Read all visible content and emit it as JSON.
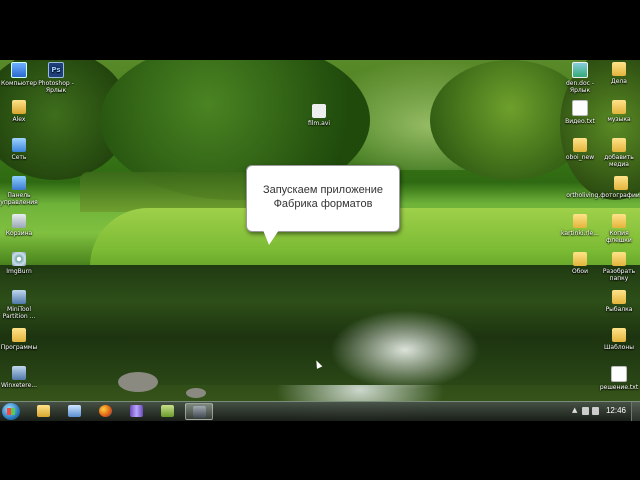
{
  "desktop_icons_left": [
    {
      "label": "Компьютер",
      "icon": "computer-icon"
    },
    {
      "label": "Photoshop - Ярлык",
      "icon": "photoshop-icon"
    },
    {
      "label": "Alex",
      "icon": "user-folder-icon"
    },
    {
      "label": "Сеть",
      "icon": "network-icon"
    },
    {
      "label": "Панель управления",
      "icon": "control-panel-icon"
    },
    {
      "label": "Корзина",
      "icon": "recycle-bin-icon"
    },
    {
      "label": "ImgBurn",
      "icon": "imgburn-icon"
    },
    {
      "label": "MiniTool Partition ...",
      "icon": "minitool-icon"
    },
    {
      "label": "Программы",
      "icon": "folder-icon"
    },
    {
      "label": "Winxetere...",
      "icon": "program-icon"
    }
  ],
  "center_icon": {
    "label": "film.avi",
    "icon": "video-file-icon"
  },
  "desktop_icons_right": [
    {
      "label": "den.doc - Ярлык",
      "icon": "shortcut-icon"
    },
    {
      "label": "Дела",
      "icon": "folder-icon"
    },
    {
      "label": "Видео.txt",
      "icon": "text-file-icon"
    },
    {
      "label": "музыка",
      "icon": "folder-icon"
    },
    {
      "label": "oboi_new",
      "icon": "folder-icon"
    },
    {
      "label": "добавить медиа",
      "icon": "folder-icon"
    },
    {
      "label": "ortholiving.фотографии",
      "icon": "folder-icon"
    },
    {
      "label": "kartinki.rle...",
      "icon": "image-folder-icon"
    },
    {
      "label": "Копия флешки",
      "icon": "folder-icon"
    },
    {
      "label": "Обои",
      "icon": "folder-icon"
    },
    {
      "label": "Разобрать папку",
      "icon": "folder-icon"
    },
    {
      "label": "Рыбалка",
      "icon": "folder-icon"
    },
    {
      "label": "Шаблоны",
      "icon": "folder-icon"
    },
    {
      "label": "решение.txt",
      "icon": "text-file-icon"
    }
  ],
  "callout": {
    "line1": "Запускаем приложение",
    "line2": "Фабрика форматов"
  },
  "taskbar": {
    "start_icon": "windows-start-icon",
    "pinned": [
      {
        "name": "explorer",
        "icon": "folder-icon"
      },
      {
        "name": "window-switch",
        "icon": "window-icon"
      },
      {
        "name": "firefox",
        "icon": "firefox-icon"
      },
      {
        "name": "visual-studio",
        "icon": "bowtie-icon"
      },
      {
        "name": "image-viewer",
        "icon": "image-icon"
      },
      {
        "name": "format-factory",
        "icon": "format-factory-icon",
        "active": true
      }
    ],
    "clock": "12:46"
  }
}
